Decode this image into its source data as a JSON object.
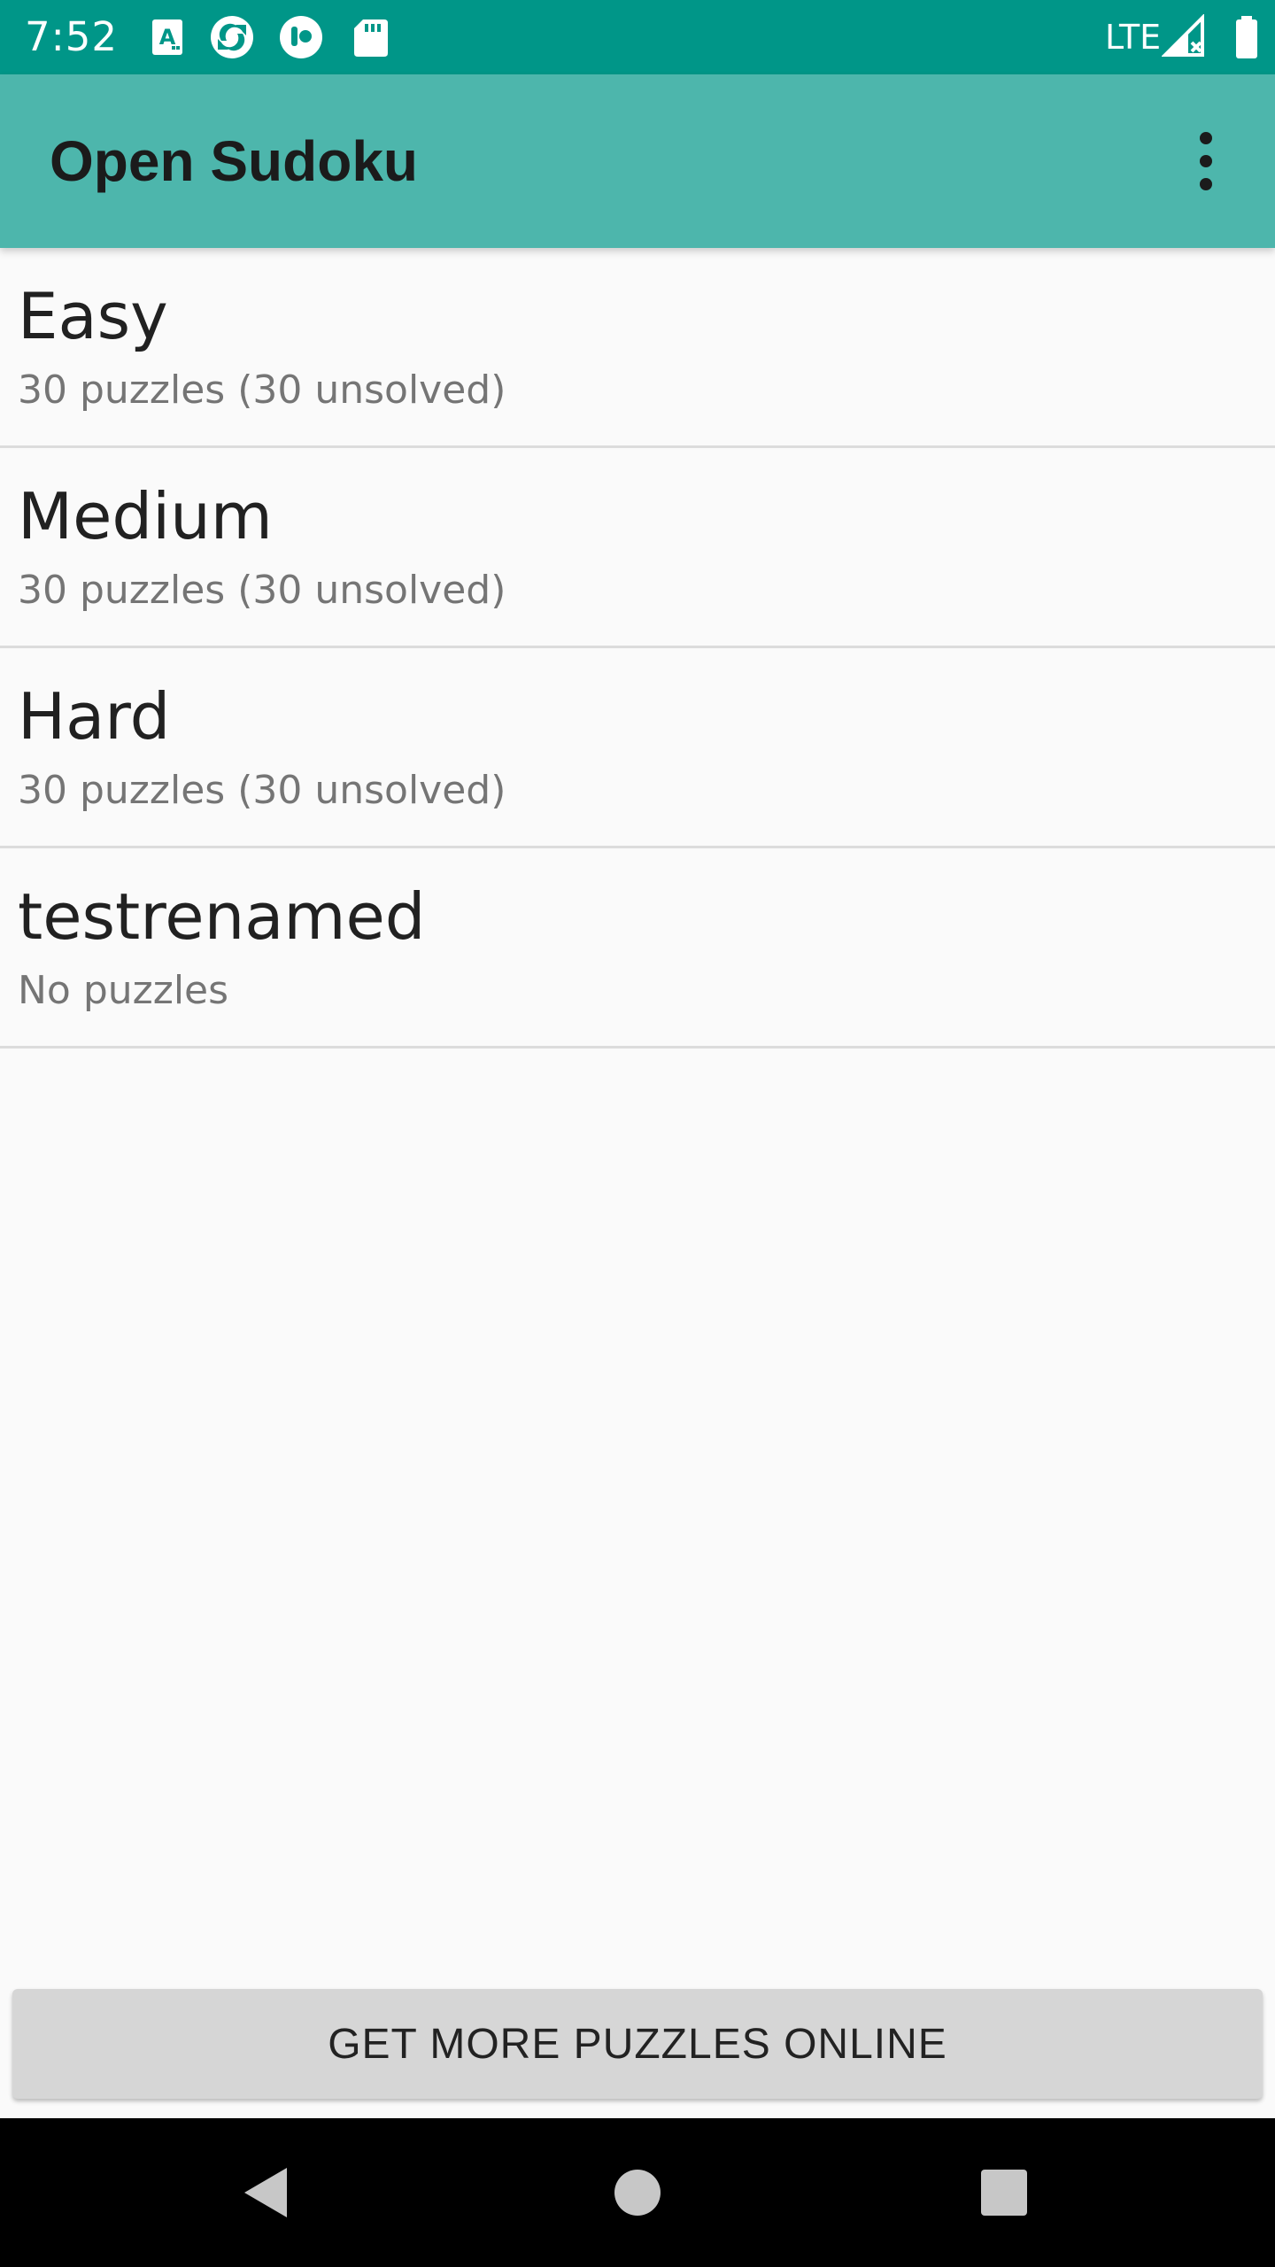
{
  "status_bar": {
    "time": "7:52",
    "network": "LTE",
    "notification_icons": [
      "accessibility-icon",
      "sync-app-icon",
      "app-circle-icon",
      "sd-card-icon"
    ],
    "background_color": "#009688"
  },
  "app_bar": {
    "title": "Open Sudoku",
    "overflow_icon": "more-vert-icon",
    "background_color": "#4DB6AC"
  },
  "folders": [
    {
      "name": "Easy",
      "detail": "30 puzzles (30 unsolved)"
    },
    {
      "name": "Medium",
      "detail": "30 puzzles (30 unsolved)"
    },
    {
      "name": "Hard",
      "detail": "30 puzzles (30 unsolved)"
    },
    {
      "name": "testrenamed",
      "detail": "No puzzles"
    }
  ],
  "actions": {
    "get_more_label": "GET MORE PUZZLES ONLINE"
  },
  "nav_bar": {
    "buttons": [
      "back-icon",
      "home-icon",
      "recents-icon"
    ]
  }
}
